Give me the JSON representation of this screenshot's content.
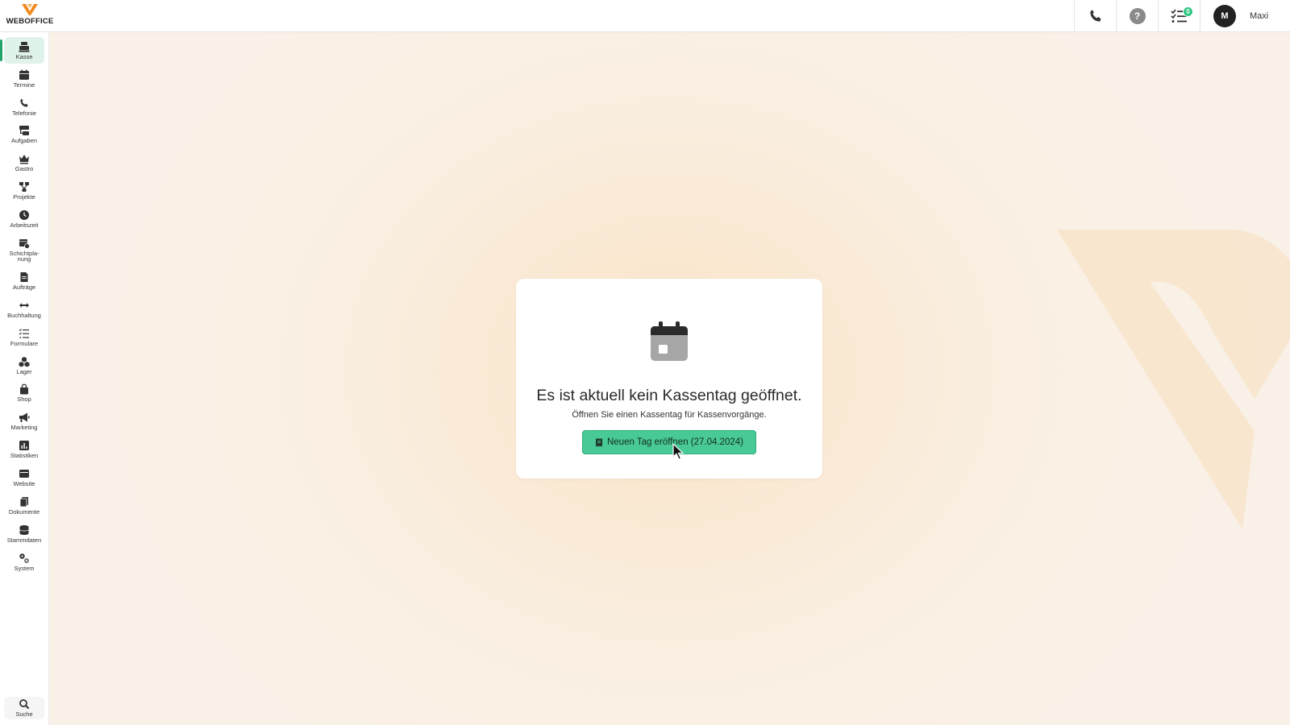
{
  "brand": {
    "name": "WEBOFFICE",
    "accent": "#f08a1c"
  },
  "topbar": {
    "phone_icon": "phone-icon",
    "help_icon": "help-icon",
    "help_glyph": "?",
    "tasks_icon": "tasks-icon",
    "tasks_badge": "0",
    "user": {
      "initial": "M",
      "name": "Maxi"
    }
  },
  "sidebar": {
    "active": "Kasse",
    "items": [
      {
        "label": "Kasse",
        "icon": "cash-register-icon"
      },
      {
        "label": "Termine",
        "icon": "calendar-icon"
      },
      {
        "label": "Telefonie",
        "icon": "phone-icon"
      },
      {
        "label": "Aufgaben",
        "icon": "tasks-icon"
      },
      {
        "label": "Gastro",
        "icon": "crown-icon"
      },
      {
        "label": "Projekte",
        "icon": "project-icon"
      },
      {
        "label": "Arbeitszeit",
        "icon": "clock-icon"
      },
      {
        "label": "Schichtpla-\nnung",
        "icon": "shift-calendar-icon"
      },
      {
        "label": "Aufträge",
        "icon": "document-icon"
      },
      {
        "label": "Buchhaltung",
        "icon": "arrows-icon"
      },
      {
        "label": "Formulare",
        "icon": "list-icon"
      },
      {
        "label": "Lager",
        "icon": "boxes-icon"
      },
      {
        "label": "Shop",
        "icon": "shopping-bag-icon"
      },
      {
        "label": "Marketing",
        "icon": "megaphone-icon"
      },
      {
        "label": "Statistiken",
        "icon": "chart-icon"
      },
      {
        "label": "Website",
        "icon": "browser-icon"
      },
      {
        "label": "Dokumente",
        "icon": "files-icon"
      },
      {
        "label": "Stammdaten",
        "icon": "database-icon"
      },
      {
        "label": "System",
        "icon": "gears-icon"
      }
    ],
    "search": {
      "label": "Suche",
      "icon": "search-icon"
    }
  },
  "main": {
    "card": {
      "icon": "calendar-icon",
      "title": "Es ist aktuell kein Kassentag geöffnet.",
      "subtitle": "Öffnen Sie einen Kassentag für Kassenvorgänge.",
      "button_label": "Neuen Tag eröffnen (27.04.2024)",
      "button_icon": "receipt-icon"
    }
  }
}
